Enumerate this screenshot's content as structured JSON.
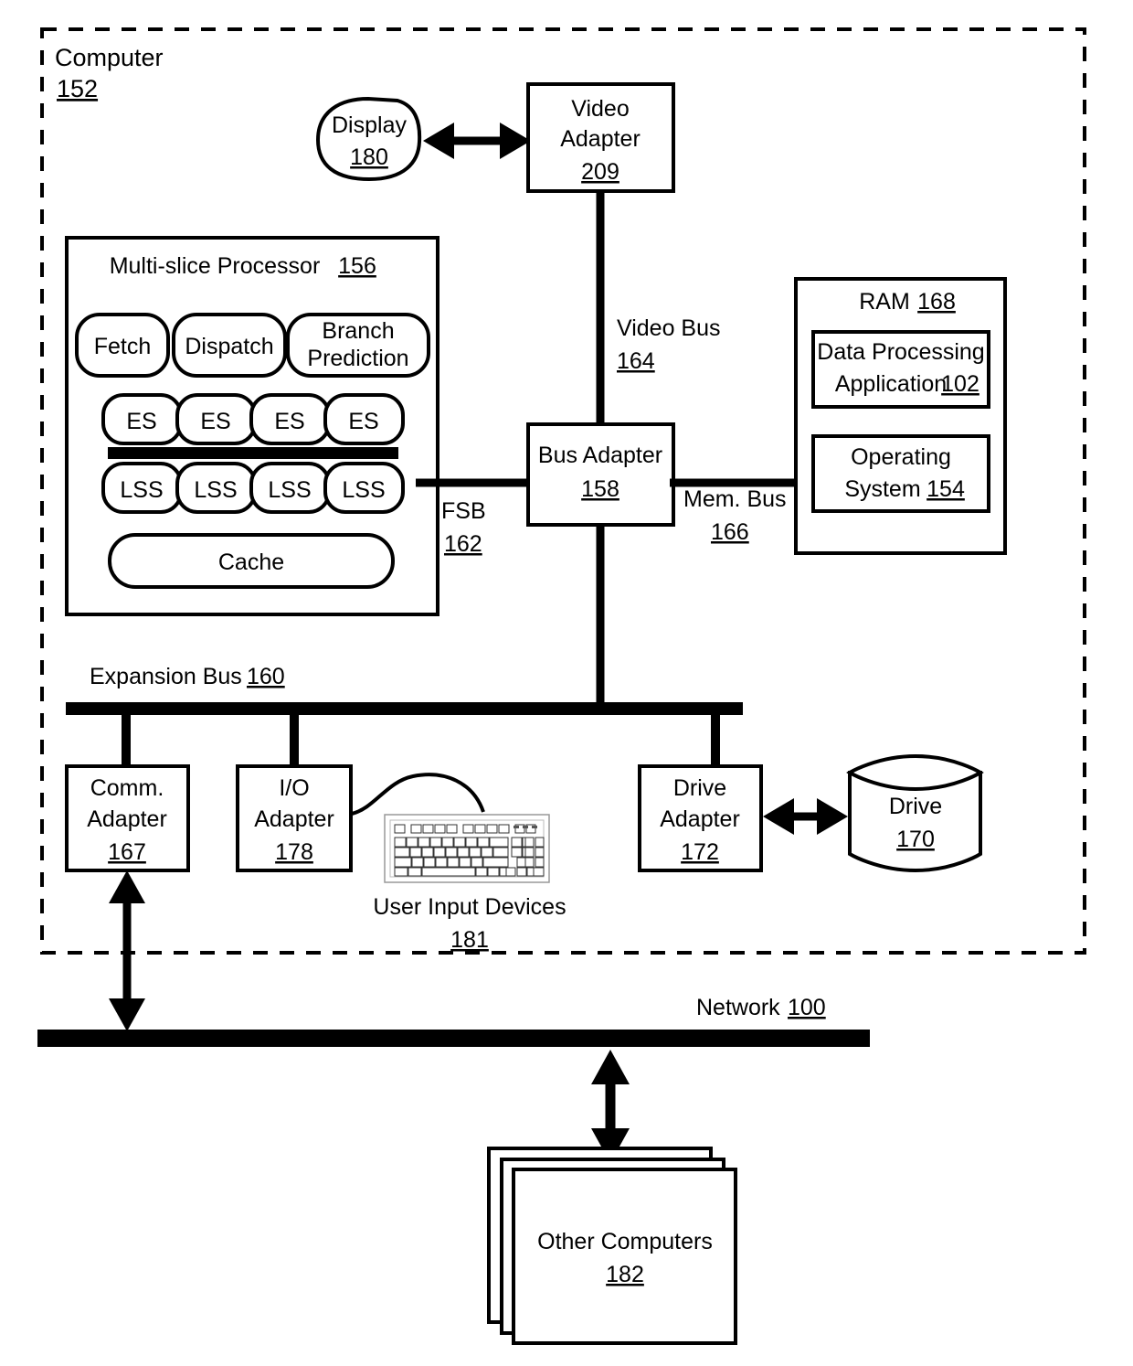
{
  "figure": {
    "type": "block-diagram",
    "title": "Computer system block diagram",
    "background": "#ffffff",
    "stroke": "#000000"
  },
  "outer_boundary": {
    "label": "Computer",
    "ref": "152",
    "style": "dashed"
  },
  "display": {
    "label": "Display",
    "ref": "180",
    "shape": "ellipse"
  },
  "video_adapter": {
    "line1": "Video",
    "line2": "Adapter",
    "ref": "209"
  },
  "processor": {
    "title": "Multi-slice Processor",
    "ref": "156",
    "units_row1": [
      {
        "label": "Fetch"
      },
      {
        "label": "Dispatch"
      },
      {
        "line1": "Branch",
        "line2": "Prediction"
      }
    ],
    "es_slices": [
      "ES",
      "ES",
      "ES",
      "ES"
    ],
    "lss_slices": [
      "LSS",
      "LSS",
      "LSS",
      "LSS"
    ],
    "cache": "Cache"
  },
  "bus_adapter": {
    "line1": "Bus Adapter",
    "ref": "158"
  },
  "buses": {
    "video_bus": {
      "label": "Video Bus",
      "ref": "164"
    },
    "mem_bus": {
      "label": "Mem. Bus",
      "ref": "166"
    },
    "fsb": {
      "label": "FSB",
      "ref": "162"
    },
    "expansion_bus": {
      "label": "Expansion Bus",
      "ref": "160"
    },
    "network": {
      "label": "Network",
      "ref": "100"
    }
  },
  "ram": {
    "title": "RAM",
    "ref": "168",
    "modules": [
      {
        "line1": "Data Processing",
        "line2": "Application",
        "ref": "102"
      },
      {
        "line1": "Operating",
        "line2": "System",
        "ref": "154"
      }
    ]
  },
  "comm_adapter": {
    "line1": "Comm.",
    "line2": "Adapter",
    "ref": "167"
  },
  "io_adapter": {
    "line1": "I/O",
    "line2": "Adapter",
    "ref": "178"
  },
  "user_input_devices": {
    "label": "User Input Devices",
    "ref": "181",
    "icon": "keyboard-icon"
  },
  "drive_adapter": {
    "line1": "Drive",
    "line2": "Adapter",
    "ref": "172"
  },
  "drive": {
    "label": "Drive",
    "ref": "170",
    "shape": "cylinder"
  },
  "other_computers": {
    "label": "Other Computers",
    "ref": "182",
    "stack_count": 3
  }
}
